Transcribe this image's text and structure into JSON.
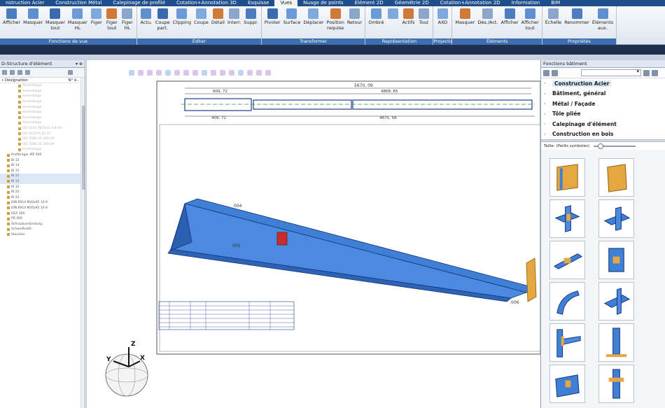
{
  "ribbon_tabs": [
    "nstruction Acier",
    "Construction Métal",
    "Calepinage de profilé",
    "Cotation+Annotation 3D",
    "Esquisse",
    "Vues",
    "Nuage de points",
    "Élément 2D",
    "Géométrie 2D",
    "Cotation+Annotation 2D",
    "Information",
    "BIM"
  ],
  "active_tab": "Vues",
  "ribbon_groups": [
    {
      "label": "Fonctions de vue",
      "buttons": [
        "Afficher",
        "Masquer",
        "Masquer\ntout",
        "Masquer\nHL",
        "Figer",
        "Figer\ntout",
        "Figer\nHL"
      ]
    },
    {
      "label": "Éditer",
      "buttons": [
        "Actu.",
        "Coupe\npart.",
        "Clipping",
        "Coupe",
        "Détail",
        "Interr.",
        "Suppr."
      ]
    },
    {
      "label": "Transformer",
      "buttons": [
        "Pivoter",
        "Surface",
        "Déplacer",
        "Position\nrequise",
        "Retour"
      ]
    },
    {
      "label": "Représentation",
      "buttons": [
        "Ombré",
        "",
        "Actifs",
        "Tout"
      ]
    },
    {
      "label": "Projections",
      "buttons": [
        "AXO"
      ]
    },
    {
      "label": "Éléments",
      "buttons": [
        "Masquer",
        "Dés./Act.",
        "Afficher",
        "Afficher\ntout"
      ]
    },
    {
      "label": "Propriétés",
      "buttons": [
        "Échelle",
        "Renommer",
        "Éléments\naux."
      ]
    }
  ],
  "left_panel": {
    "title": "D-Structure d'élément",
    "header_left": "• Désignation",
    "header_right": "N° é..",
    "tree": [
      {
        "text": "Assemblage",
        "style": "dim"
      },
      {
        "text": "Assemblage",
        "style": "dim"
      },
      {
        "text": "Assemblage",
        "style": "dim"
      },
      {
        "text": "Assemblage",
        "style": "dim"
      },
      {
        "text": "Assemblage",
        "style": "dim"
      },
      {
        "text": "Assemblage",
        "style": "dim"
      },
      {
        "text": "Assemblage",
        "style": "dim"
      },
      {
        "text": "Assemblage",
        "style": "dim"
      },
      {
        "text": "ISO 4014 M20x55 8.8-HV",
        "style": "dim"
      },
      {
        "text": "ISO 4032 M 20 10",
        "style": "dim"
      },
      {
        "text": "ISO 7090 20 200 HV",
        "style": "dim"
      },
      {
        "text": "ISO 7090 20 200 HV",
        "style": "dim"
      },
      {
        "text": "Assemblage",
        "style": "dim"
      },
      {
        "text": "Profilträger IPE 400",
        "style": ""
      },
      {
        "text": "Bl 12",
        "style": ""
      },
      {
        "text": "Bl 14",
        "style": ""
      },
      {
        "text": "Bl 15",
        "style": ""
      },
      {
        "text": "Bl 25",
        "style": "sel"
      },
      {
        "text": "Bl 15",
        "style": "sel"
      },
      {
        "text": "Bl 15",
        "style": ""
      },
      {
        "text": "Bl 20",
        "style": ""
      },
      {
        "text": "Bl 22",
        "style": ""
      },
      {
        "text": "DIN 6914 M20x95 10.9",
        "style": ""
      },
      {
        "text": "DIN 6914 M20x95 10.9",
        "style": ""
      },
      {
        "text": "HEA 160",
        "style": ""
      },
      {
        "text": "PR 400",
        "style": ""
      },
      {
        "text": "Schraubverbindung",
        "style": ""
      },
      {
        "text": "Schweißnaht",
        "style": ""
      },
      {
        "text": "Steuilser",
        "style": ""
      }
    ]
  },
  "right_panel": {
    "title": "Fonctions bâtiment",
    "categories": [
      "Construction Acier",
      "Bâtiment, général",
      "Métal / Façade",
      "Tôle pliée",
      "Calepinage d'élément",
      "Construction en bois"
    ],
    "size_label": "Taille:",
    "size_value": "(Petits symboles)",
    "size_level": 0.12
  },
  "drawing": {
    "dims_top": [
      "5670, 09",
      "609, 72",
      "4868, 85"
    ],
    "dims_bottom": [
      "409, 72",
      "4875, 58"
    ],
    "beam_labels": [
      "004",
      "005",
      "006"
    ]
  },
  "colors": {
    "tab_bar": "#1f4e8c",
    "group_label": "#3d6fb0",
    "beam_blue": "#3f7fd6",
    "plate_orange": "#e5a742"
  }
}
